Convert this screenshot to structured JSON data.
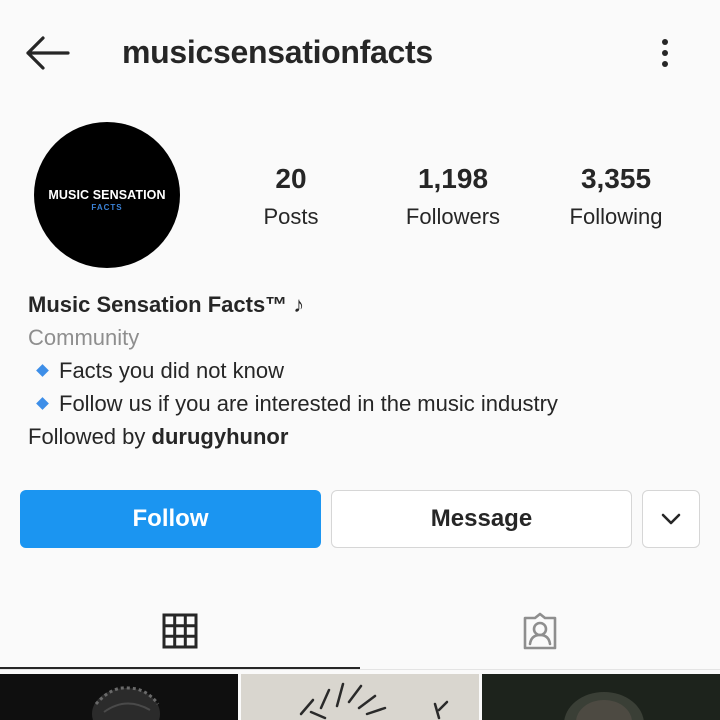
{
  "header": {
    "username": "musicsensationfacts",
    "back_icon": "arrow-left-icon",
    "more_icon": "more-vertical-icon"
  },
  "profile": {
    "avatar_text_main": "MUSIC SENSATION",
    "avatar_text_sub": "FACTS",
    "stats": {
      "posts": {
        "value": "20",
        "label": "Posts"
      },
      "followers": {
        "value": "1,198",
        "label": "Followers"
      },
      "following": {
        "value": "3,355",
        "label": "Following"
      }
    }
  },
  "bio": {
    "name": "Music Sensation Facts™ ♪",
    "category": "Community",
    "lines": [
      "Facts you did not know",
      "Follow us if you are interested in the music industry"
    ],
    "followed_by_prefix": "Followed by ",
    "followed_by_user": "durugyhunor"
  },
  "actions": {
    "follow_label": "Follow",
    "message_label": "Message",
    "dropdown_icon": "chevron-down-icon"
  },
  "tabs": [
    {
      "icon": "grid-icon",
      "active": true
    },
    {
      "icon": "tagged-person-icon",
      "active": false
    }
  ],
  "colors": {
    "follow_button": "#1b95f1",
    "bullet": "#3d8ee8",
    "secondary_text": "#8e8e8e",
    "primary_text": "#262626"
  }
}
